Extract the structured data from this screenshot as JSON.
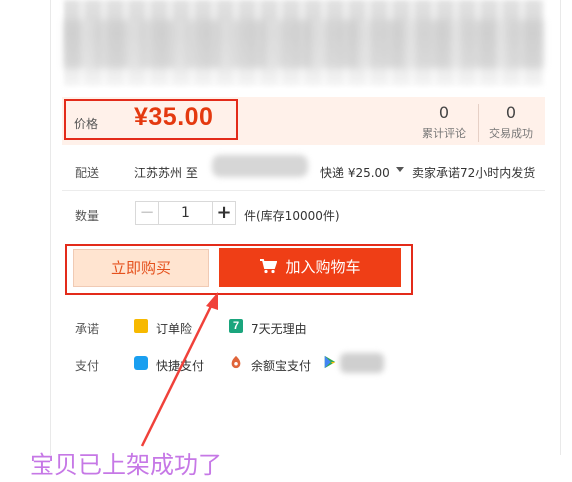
{
  "price": {
    "label": "价格",
    "value": "¥35.00"
  },
  "stats": [
    {
      "count": "0",
      "label": "累计评论"
    },
    {
      "count": "0",
      "label": "交易成功"
    }
  ],
  "shipping": {
    "label": "配送",
    "from": "江苏苏州 至",
    "method": "快递 ¥25.00",
    "promise": "卖家承诺72小时内发货"
  },
  "quantity": {
    "label": "数量",
    "minus": "−",
    "value": "1",
    "plus": "+",
    "stock": "件(库存10000件)"
  },
  "actions": {
    "buy_now": "立即购买",
    "add_cart": "加入购物车"
  },
  "guarantee": {
    "label": "承诺",
    "items": [
      {
        "icon": "order-insurance-icon",
        "text": "订单险"
      },
      {
        "icon": "seven-day-return-icon",
        "glyph": "7",
        "text": "7天无理由"
      }
    ]
  },
  "payment": {
    "label": "支付",
    "items": [
      {
        "icon": "quick-pay-icon",
        "text": "快捷支付"
      },
      {
        "icon": "yuebao-icon",
        "text": "余额宝支付"
      },
      {
        "icon": "play-store-icon",
        "text": ""
      }
    ]
  },
  "annotation": {
    "caption": "宝贝已上架成功了"
  },
  "colors": {
    "accent": "#e4390f",
    "highlight_box": "#e32b1a",
    "cart_button": "#ef3e16",
    "caption": "#c678e6"
  }
}
